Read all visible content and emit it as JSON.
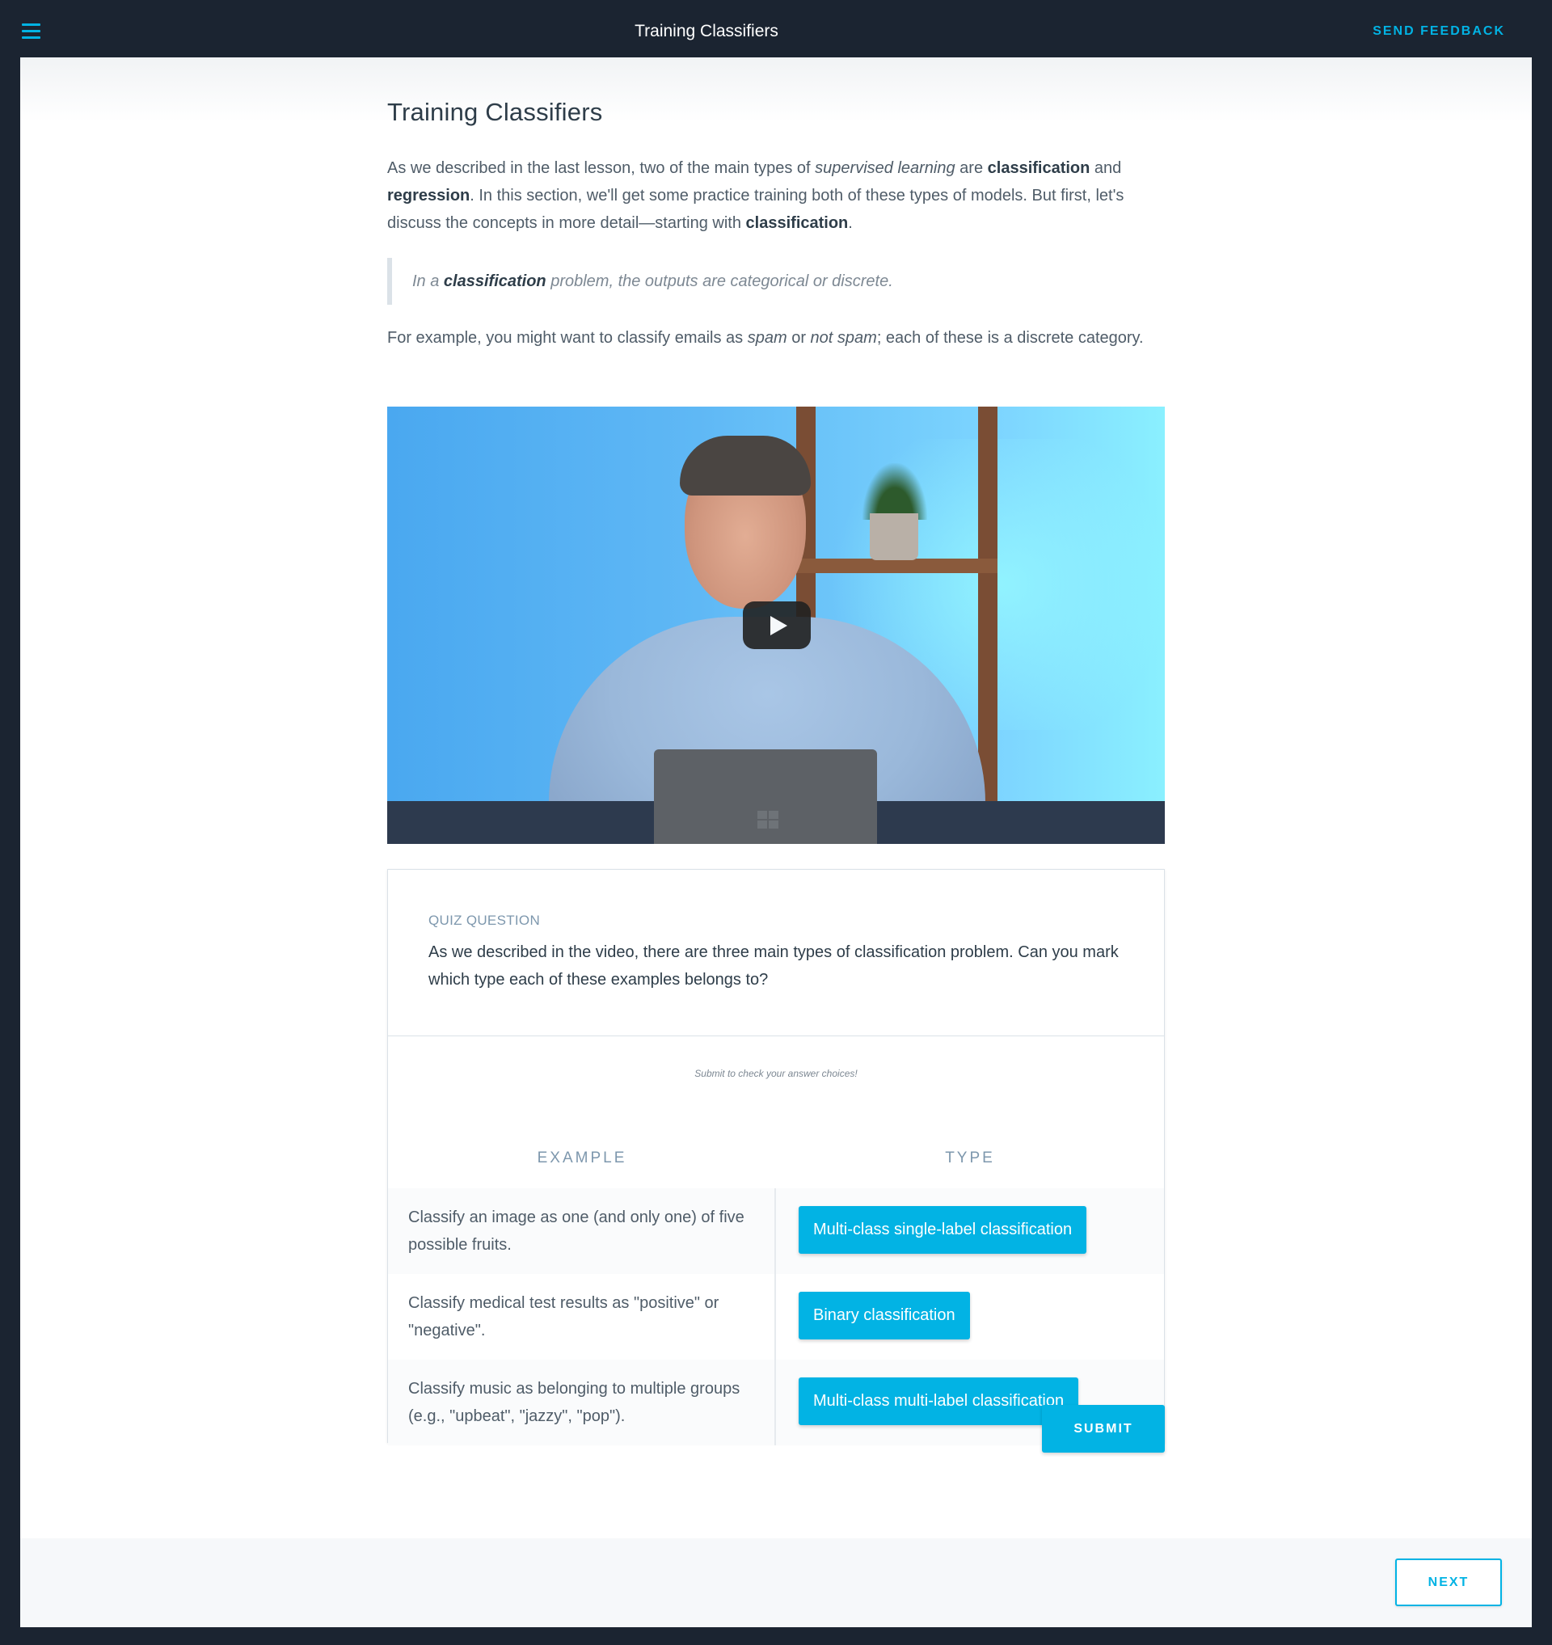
{
  "header": {
    "title": "Training Classifiers",
    "feedback_label": "SEND FEEDBACK",
    "menu_icon": "hamburger-menu-icon",
    "accent_color": "#02b3e4"
  },
  "lesson": {
    "title": "Training Classifiers",
    "intro": {
      "t1": "As we described in the last lesson, two of the main types of ",
      "t2": "supervised learning",
      "t3": " are ",
      "t4": "classification",
      "t5": " and ",
      "t6": "regression",
      "t7": ". In this section, we'll get some practice training both of these types of models. But first, let's discuss the concepts in more detail—starting with ",
      "t8": "classification",
      "t9": "."
    },
    "quote": {
      "t1": "In a ",
      "t2": "classification",
      "t3": " problem, the outputs are categorical or discrete."
    },
    "example": {
      "t1": "For example, you might want to classify emails as ",
      "t2": "spam",
      "t3": " or ",
      "t4": "not spam",
      "t5": "; each of these is a discrete category."
    },
    "video": {
      "play_icon": "play-icon"
    }
  },
  "quiz": {
    "label": "QUIZ QUESTION",
    "question": "As we described in the video, there are three main types of classification problem. Can you mark which type each of these examples belongs to?",
    "hint": "Submit to check your answer choices!",
    "columns": [
      "EXAMPLE",
      "TYPE"
    ],
    "rows": [
      {
        "example": "Classify an image as one (and only one) of five possible fruits.",
        "type": "Multi-class single-label classification"
      },
      {
        "example": "Classify medical test results as \"positive\" or \"negative\".",
        "type": "Binary classification"
      },
      {
        "example": "Classify music as belonging to multiple groups (e.g., \"upbeat\", \"jazzy\", \"pop\").",
        "type": "Multi-class multi-label classification"
      }
    ],
    "submit_label": "SUBMIT"
  },
  "footer": {
    "next_label": "NEXT"
  }
}
